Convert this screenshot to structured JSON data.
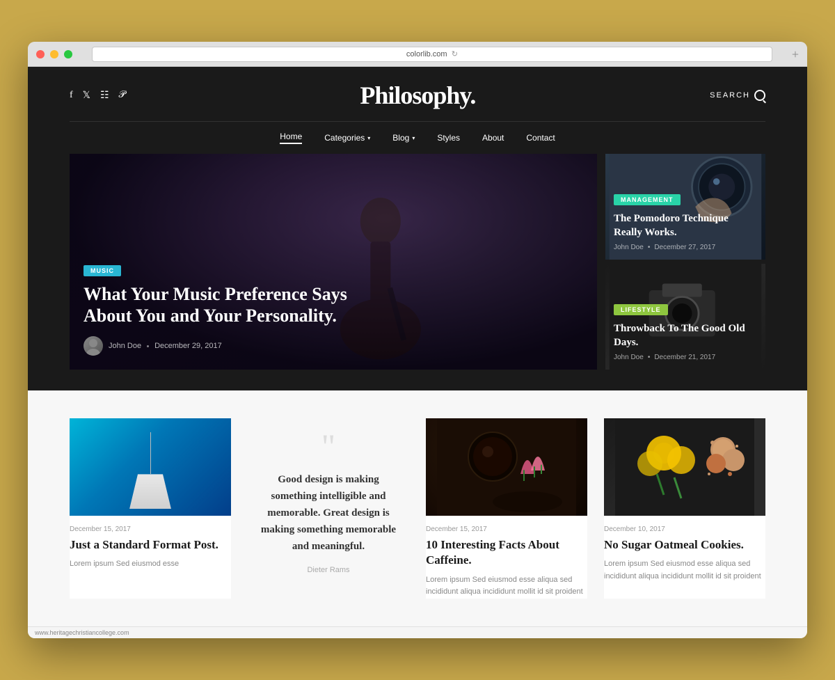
{
  "browser": {
    "url": "colorlib.com",
    "status_url": "www.heritagechristiancollege.com",
    "reload_icon": "↻"
  },
  "site": {
    "title": "Philosophy.",
    "search_label": "SEARCH"
  },
  "social": {
    "icons": [
      "f",
      "t",
      "i",
      "p"
    ],
    "names": [
      "facebook",
      "twitter",
      "instagram",
      "pinterest"
    ]
  },
  "nav": {
    "items": [
      {
        "label": "Home",
        "active": true,
        "has_arrow": false
      },
      {
        "label": "Categories",
        "active": false,
        "has_arrow": true
      },
      {
        "label": "Blog",
        "active": false,
        "has_arrow": true
      },
      {
        "label": "Styles",
        "active": false,
        "has_arrow": false
      },
      {
        "label": "About",
        "active": false,
        "has_arrow": false
      },
      {
        "label": "Contact",
        "active": false,
        "has_arrow": false
      }
    ]
  },
  "hero": {
    "main": {
      "tag": "MUSIC",
      "title": "What Your Music Preference Says About You and Your Personality.",
      "author": "John Doe",
      "date": "December 29, 2017"
    },
    "card1": {
      "tag": "MANAGEMENT",
      "title": "The Pomodoro Technique Really Works.",
      "author": "John Doe",
      "dot": "•",
      "date": "December 27, 2017"
    },
    "card2": {
      "tag": "LIFESTYLE",
      "title": "Throwback To The Good Old Days.",
      "author": "John Doe",
      "dot": "•",
      "date": "December 21, 2017"
    }
  },
  "posts": [
    {
      "type": "image",
      "image_type": "light",
      "date": "December 15, 2017",
      "title": "Just a Standard Format Post.",
      "excerpt": "Lorem ipsum Sed eiusmod esse"
    },
    {
      "type": "quote",
      "quote_marks": "““",
      "quote_text": "Good design is making something intelligible and memorable. Great design is making something memorable and meaningful.",
      "quote_author": "Dieter Rams"
    },
    {
      "type": "image",
      "image_type": "coffee",
      "date": "December 15, 2017",
      "title": "10 Interesting Facts About Caffeine.",
      "excerpt": "Lorem ipsum Sed eiusmod esse aliqua sed incididunt aliqua incididunt mollit id sit proident"
    },
    {
      "type": "image",
      "image_type": "flowers",
      "date": "December 10, 2017",
      "title": "No Sugar Oatmeal Cookies.",
      "excerpt": "Lorem ipsum Sed eiusmod esse aliqua sed incididunt aliqua incididunt mollit id sit proident"
    }
  ]
}
